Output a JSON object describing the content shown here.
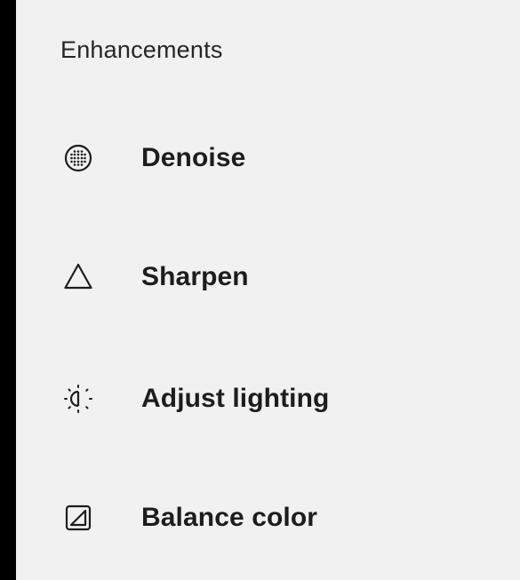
{
  "section": {
    "title": "Enhancements"
  },
  "items": [
    {
      "label": "Denoise",
      "icon": "denoise-icon"
    },
    {
      "label": "Sharpen",
      "icon": "triangle-icon"
    },
    {
      "label": "Adjust lighting",
      "icon": "lighting-icon"
    },
    {
      "label": "Balance color",
      "icon": "balance-color-icon"
    }
  ],
  "colors": {
    "background_outer": "#000000",
    "panel": "#f1f1f1",
    "text": "#1d1d1d"
  }
}
